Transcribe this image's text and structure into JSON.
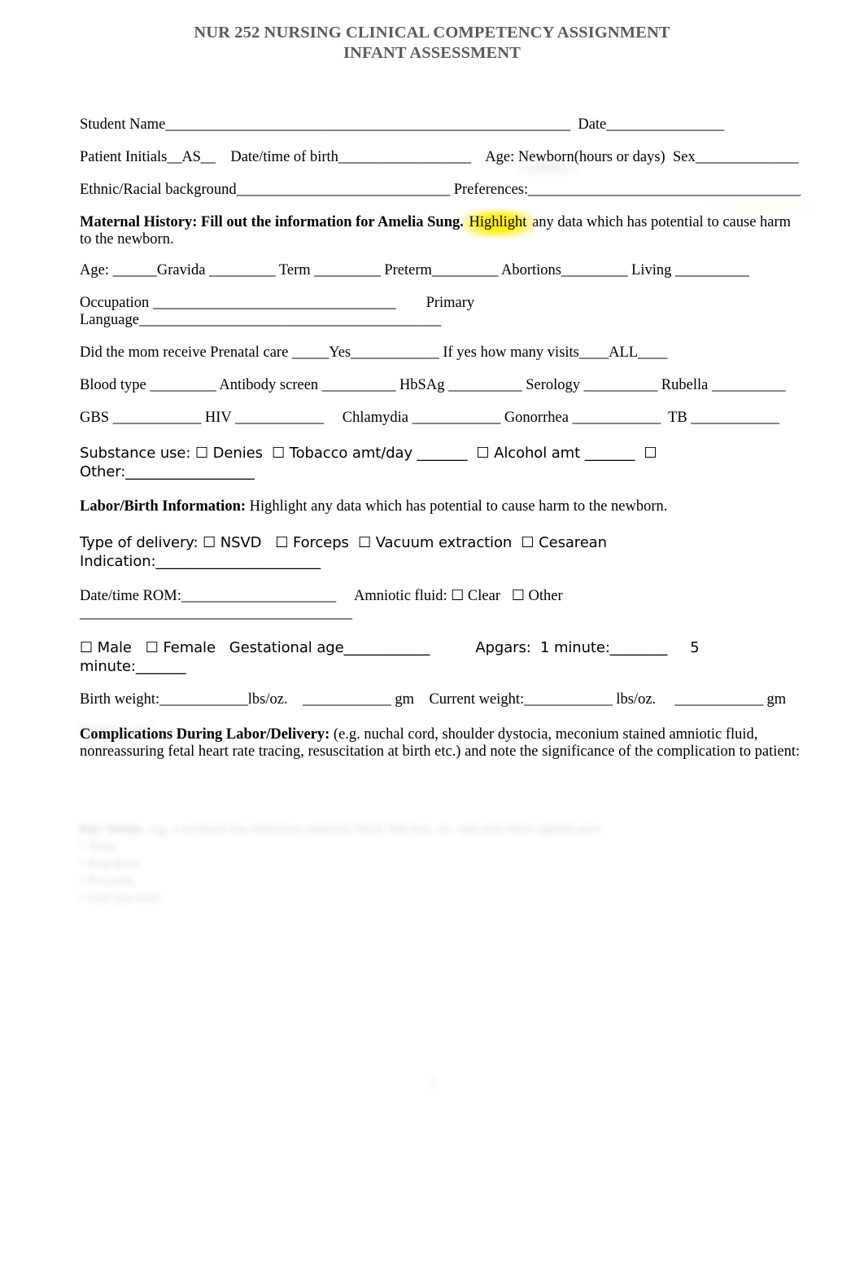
{
  "title": {
    "line1": "NUR 252 NURSING CLINICAL COMPETENCY ASSIGNMENT",
    "line2": "INFANT ASSESSMENT",
    "color": "#5a5a5a"
  },
  "identification": {
    "student_name_label": "Student Name",
    "student_name_rule": "_______________________________________________________",
    "date_label": "  Date",
    "date_rule": "________________",
    "patient_initials_label": "Patient Initials",
    "patient_initials_value": "__AS__",
    "dob_label": "    Date/time of birth",
    "dob_rule": "__________________",
    "age_label": "    Age: Newborn(hours or days)",
    "sex_label": "  Sex",
    "sex_rule": "______________",
    "ethnic_label": "Ethnic/Racial background",
    "ethnic_rule": "_____________________________",
    "preferences_label": " Preferences:",
    "preferences_rule": "_____________________________________"
  },
  "maternal_history": {
    "heading": "Maternal History: Fill out the information for Amelia Sung.",
    "highlight_word": "Highlight",
    "instruction_rest": " any data which has potential to cause harm to the newborn",
    "instruction_tail": ".",
    "age_label": "Age: ",
    "age_rule": "______",
    "gravida_label": "Gravida ",
    "gravida_rule": "_________",
    "term_label": " Term ",
    "term_rule": "_________",
    "preterm_label": " Preterm",
    "preterm_rule": "_________",
    "abortions_label": " Abortions",
    "abortions_rule": "_________",
    "living_label": " Living ",
    "living_rule": "__________",
    "occupation_label": "Occupation ",
    "occupation_rule": "_________________________________",
    "primary_language_label": "        Primary Language",
    "primary_language_rule": "_________________________________________",
    "prenatal_label": "Did the mom receive Prenatal care ",
    "prenatal_rule1": "_____",
    "prenatal_yes": "Yes",
    "prenatal_rule2": "____________",
    "visits_label": " If yes how many visits",
    "visits_rule1": "____",
    "visits_value": "ALL",
    "visits_rule2": "____",
    "blood_type_label": "Blood type ",
    "blood_type_rule": "_________",
    "antibody_label": " Antibody screen ",
    "antibody_rule": "__________",
    "hbsag_label": " HbSAg ",
    "hbsag_rule": "__________",
    "serology_label": " Serology ",
    "serology_rule": "__________",
    "rubella_label": " Rubella ",
    "rubella_rule": "__________",
    "gbs_label": "GBS ",
    "gbs_rule": "____________",
    "hiv_label": " HIV ",
    "hiv_rule": "____________",
    "chlamydia_label": "     Chlamydia ",
    "chlamydia_rule": "____________",
    "gonorrhea_label": " Gonorrhea ",
    "gonorrhea_rule": "____________",
    "tb_label": "  TB ",
    "tb_rule": "____________"
  },
  "substance_use": {
    "label": "Substance use: ",
    "checkbox": "☐",
    "denies": " Denies",
    "tobacco": " Tobacco amt/day ",
    "tobacco_rule": "_______",
    "alcohol": " Alcohol amt ",
    "alcohol_rule": "_______",
    "other_label": "Other:",
    "other_rule": "__________________"
  },
  "labor_birth": {
    "heading": "Labor/Birth Information:",
    "instruction": " Highlight any data which has potential to cause harm to the newborn.",
    "delivery_label": "Type of delivery: ",
    "checkbox": "☐",
    "nsvd": " NSVD",
    "forceps": " Forceps",
    "vacuum": " Vacuum extraction",
    "cesarean": " Cesarean",
    "indication_label": "Indication:",
    "indication_rule": "_______________________",
    "rom_label": "Date/time ROM:",
    "rom_rule": "_____________________",
    "amniotic_label": "     Amniotic fluid: ",
    "amniotic_clear": " Clear",
    "amniotic_other": " Other ",
    "amniotic_other_rule": "_____________________________________",
    "male": " Male",
    "female": " Female",
    "gestational_label": "   Gestational age",
    "gestational_rule": "____________",
    "apgars_label": "          Apgars:  1 minute:",
    "apgar1_rule": "________",
    "apgar5_label": "     5 minute:",
    "apgar5_rule": "_______",
    "birth_weight_label": "Birth weight:",
    "birth_weight_rule": "____________",
    "birth_weight_unit": "lbs/oz.    ",
    "birth_weight_gm_rule": "____________",
    "birth_weight_gm": " gm",
    "current_weight_label": "    Current weight:",
    "current_weight_rule": "____________",
    "current_weight_unit": " lbs/oz.     ",
    "current_weight_gm_rule": "____________",
    "current_weight_gm": " gm"
  },
  "complications": {
    "heading": "Complications During Labor/Delivery:",
    "body": " (e.g. nuchal cord, shoulder dystocia, meconium stained amniotic fluid, nonreassuring fetal heart rate tracing, resuscitation at birth etc.) and note the significance of the complication to patient:"
  },
  "redacted": {
    "note_a": "Nuchal cord",
    "note_b_lead": "Key Terms",
    "note_b_rest": ": e.g. a newborn has infection, amniotic fluid, RH test, etc. and note their significance",
    "note_b_line2": "• Term",
    "note_b_line3": "• Post term",
    "note_b_line4": "• Pre term",
    "note_b_line5": "• Late pre term",
    "page_marker": "2"
  }
}
